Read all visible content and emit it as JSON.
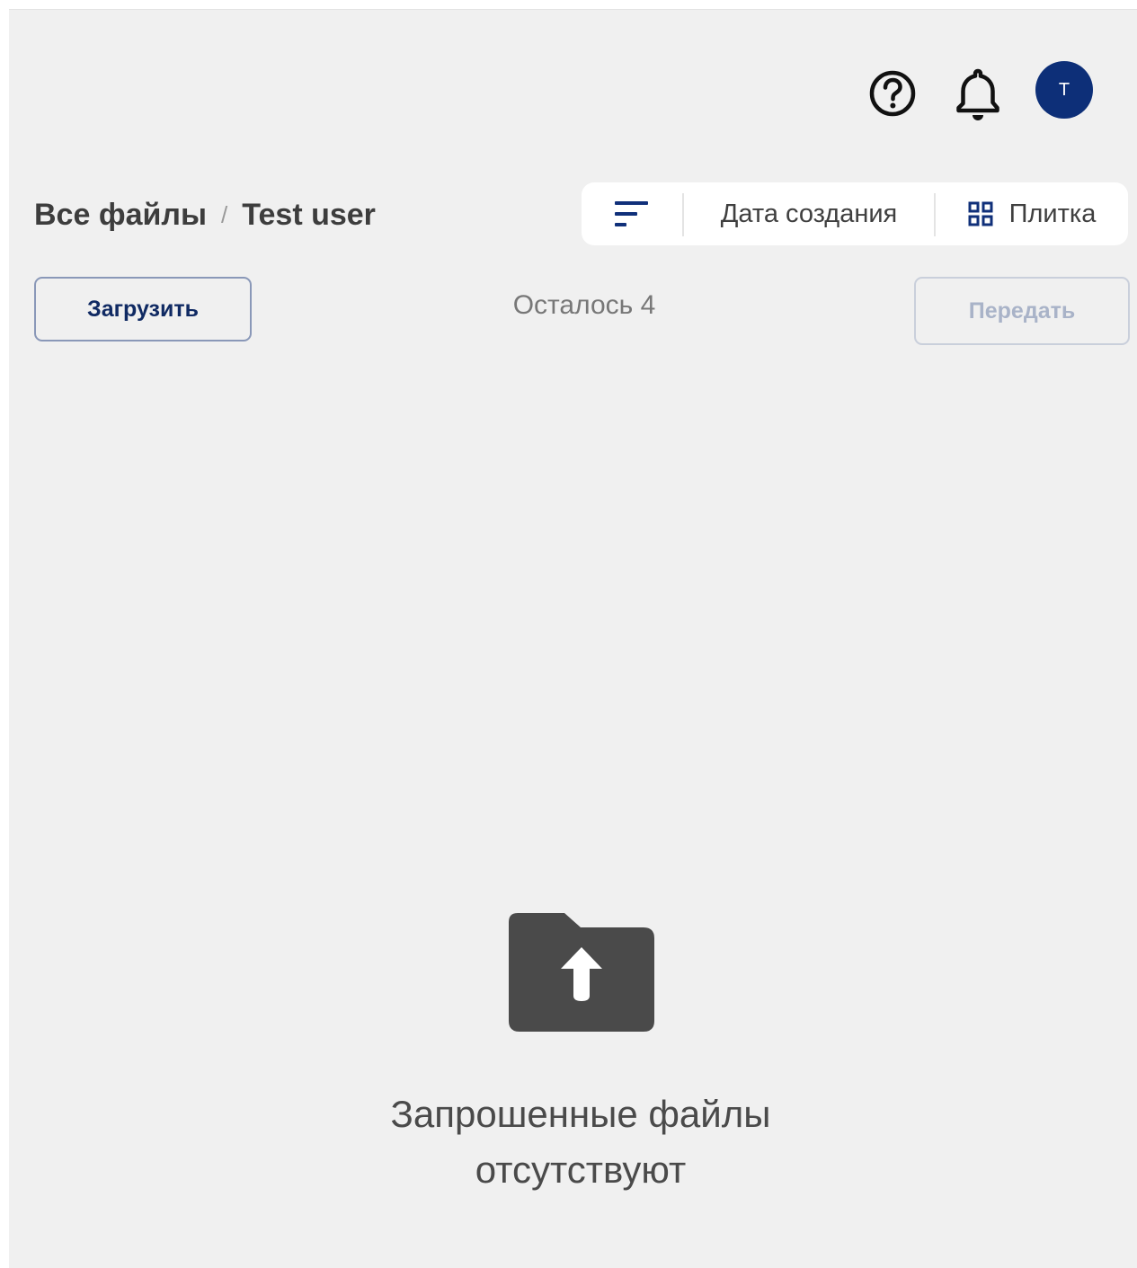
{
  "header": {
    "help_icon": "help-circle-icon",
    "notifications_icon": "bell-icon",
    "avatar_initial": "T",
    "avatar_color": "#0d2f78"
  },
  "breadcrumb": {
    "root": "Все файлы",
    "separator": "/",
    "current": "Test user"
  },
  "toolbar": {
    "sort_icon": "sort-icon",
    "sort_field": "Дата создания",
    "view_icon": "grid-icon",
    "view_label": "Плитка"
  },
  "actions": {
    "upload_label": "Загрузить",
    "remaining_text": "Осталось 4",
    "transfer_label": "Передать"
  },
  "empty_state": {
    "icon": "folder-upload-icon",
    "line1": "Запрошенные файлы",
    "line2": "отсутствуют"
  }
}
